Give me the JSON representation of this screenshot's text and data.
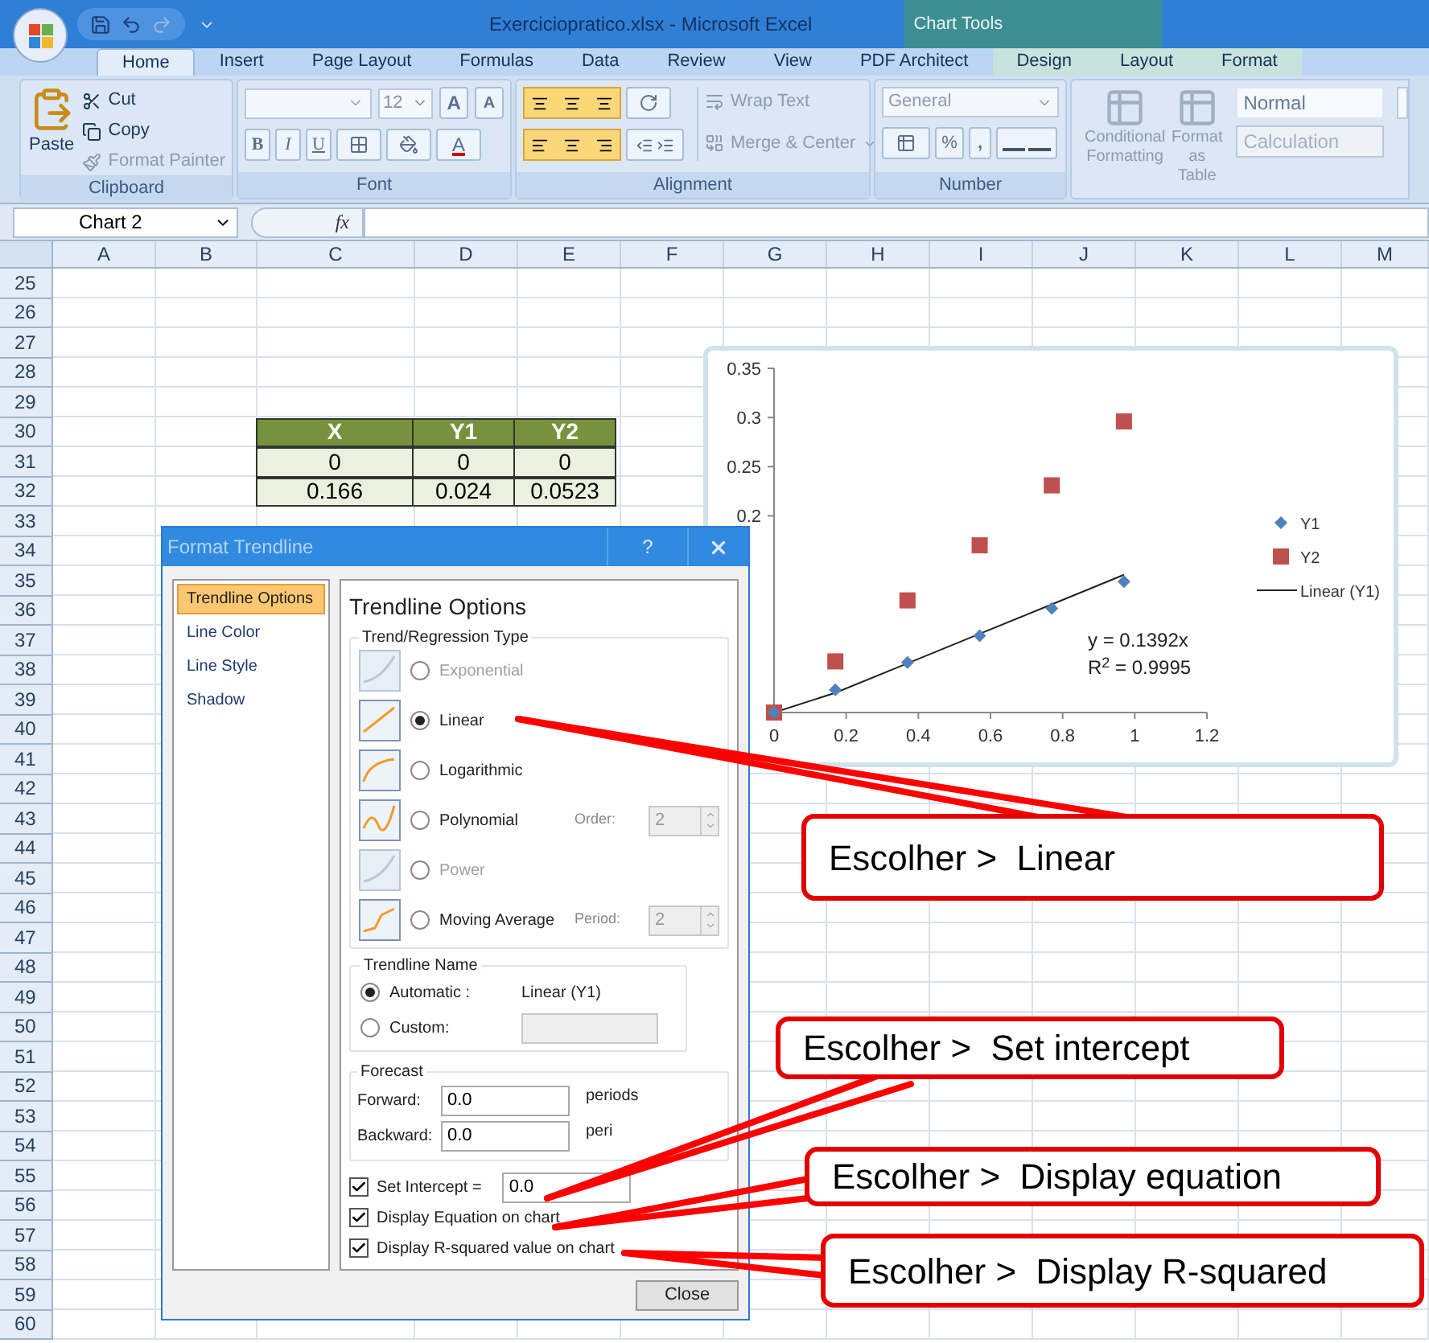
{
  "window": {
    "title": "Exerciciopratico.xlsx - Microsoft Excel",
    "context_group": "Chart Tools"
  },
  "ribbon_tabs": [
    {
      "label": "Home",
      "selected": true,
      "contextual": false
    },
    {
      "label": "Insert",
      "selected": false,
      "contextual": false
    },
    {
      "label": "Page Layout",
      "selected": false,
      "contextual": false
    },
    {
      "label": "Formulas",
      "selected": false,
      "contextual": false
    },
    {
      "label": "Data",
      "selected": false,
      "contextual": false
    },
    {
      "label": "Review",
      "selected": false,
      "contextual": false
    },
    {
      "label": "View",
      "selected": false,
      "contextual": false
    },
    {
      "label": "PDF Architect",
      "selected": false,
      "contextual": false
    },
    {
      "label": "Design",
      "selected": false,
      "contextual": true
    },
    {
      "label": "Layout",
      "selected": false,
      "contextual": true
    },
    {
      "label": "Format",
      "selected": false,
      "contextual": true
    }
  ],
  "ribbon": {
    "clipboard": {
      "label": "Clipboard",
      "paste": "Paste",
      "commands": [
        {
          "label": "Cut",
          "disabled": false
        },
        {
          "label": "Copy",
          "disabled": false
        },
        {
          "label": "Format Painter",
          "disabled": true
        }
      ]
    },
    "font": {
      "label": "Font",
      "size": "12",
      "grow": "A",
      "shrink": "A",
      "styles": [
        "B",
        "I",
        "U"
      ],
      "font_color_button": "A"
    },
    "alignment": {
      "label": "Alignment",
      "wrap_text": "Wrap Text",
      "merge_center": "Merge & Center"
    },
    "number": {
      "label": "Number",
      "format": "General",
      "percent": "%",
      "comma": ","
    },
    "styles": {
      "commands": [
        "Conditional Formatting",
        "Format as Table"
      ],
      "cells": [
        "Normal",
        "Calculation"
      ]
    }
  },
  "formula_bar": {
    "name_box": "Chart 2",
    "function_label": "fx"
  },
  "grid": {
    "columns": [
      "A",
      "B",
      "C",
      "D",
      "E",
      "F",
      "G",
      "H",
      "I",
      "J",
      "K",
      "L",
      "M"
    ],
    "rows": [
      "25",
      "26",
      "27",
      "28",
      "29",
      "30",
      "31",
      "32",
      "33",
      "34",
      "35",
      "36",
      "37",
      "38",
      "39",
      "40",
      "41",
      "42",
      "43",
      "44",
      "45",
      "46",
      "47",
      "48",
      "49",
      "50",
      "51",
      "52",
      "53",
      "54",
      "55",
      "56",
      "57",
      "58",
      "59",
      "60"
    ]
  },
  "table": {
    "columns": [
      "X",
      "Y1",
      "Y2"
    ],
    "rows": [
      [
        "0",
        "0",
        "0"
      ],
      [
        "0.166",
        "0.024",
        "0.0523"
      ]
    ]
  },
  "chart": {
    "chart_data": {
      "type": "scatter",
      "x": [
        0,
        0.17,
        0.37,
        0.57,
        0.77,
        0.97
      ],
      "series": [
        {
          "name": "Y1",
          "color": "#4f81bd",
          "values": [
            0,
            0.023,
            0.051,
            0.078,
            0.106,
            0.133
          ]
        },
        {
          "name": "Y2",
          "color": "#c0504d",
          "values": [
            0,
            0.052,
            0.114,
            0.17,
            0.231,
            0.296
          ]
        },
        {
          "name": "Linear (Y1)",
          "color": "#222222",
          "values": [
            0,
            0.02,
            0.05,
            0.08,
            0.11,
            0.14
          ],
          "type": "line"
        }
      ],
      "legend": "right",
      "xlim": [
        0,
        1.2
      ],
      "ylim": [
        0,
        0.35
      ],
      "xticks": [
        0,
        0.2,
        0.4,
        0.6,
        0.8,
        1,
        1.2
      ],
      "yticks": [
        0.2,
        0.25,
        0.3,
        0.35
      ],
      "annotations": [
        "y = 0.1392x",
        "R$^{2}$ = 0.9995"
      ]
    }
  },
  "dialog": {
    "title": "Format Trendline",
    "help": "?",
    "nav": [
      {
        "label": "Trendline Options",
        "selected": true
      },
      {
        "label": "Line Color",
        "selected": false
      },
      {
        "label": "Line Style",
        "selected": false
      },
      {
        "label": "Shadow",
        "selected": false
      }
    ],
    "heading": "Trendline Options",
    "regression": {
      "legend": "Trend/Regression Type",
      "options": [
        {
          "label": "Exponential",
          "selected": false,
          "disabled": true
        },
        {
          "label": "Linear",
          "selected": true,
          "disabled": false
        },
        {
          "label": "Logarithmic",
          "selected": false,
          "disabled": false
        },
        {
          "label": "Polynomial",
          "selected": false,
          "disabled": false,
          "param_label": "Order:",
          "param_value": "2"
        },
        {
          "label": "Power",
          "selected": false,
          "disabled": true
        },
        {
          "label": "Moving Average",
          "selected": false,
          "disabled": false,
          "param_label": "Period:",
          "param_value": "2"
        }
      ]
    },
    "trendline_name": {
      "legend": "Trendline Name",
      "options": [
        {
          "label": "Automatic :",
          "selected": true,
          "value": "Linear (Y1)"
        },
        {
          "label": "Custom:",
          "selected": false
        }
      ]
    },
    "forecast": {
      "legend": "Forecast",
      "fields": [
        {
          "label": "Forward:",
          "value": "0.0",
          "unit": "periods"
        },
        {
          "label": "Backward:",
          "value": "0.0",
          "unit": "peri"
        }
      ]
    },
    "checks": [
      {
        "label": "Set Intercept =",
        "checked": true,
        "value": "0.0"
      },
      {
        "label": "Display Equation on chart",
        "checked": true
      },
      {
        "label": "Display R-squared value on chart",
        "checked": true
      }
    ],
    "close_button": "Close"
  },
  "callouts": [
    {
      "text": "Escolher >  Linear"
    },
    {
      "text": "Escolher >  Set intercept"
    },
    {
      "text": "Escolher >  Display equation"
    },
    {
      "text": "Escolher >  Display R-squared"
    }
  ]
}
